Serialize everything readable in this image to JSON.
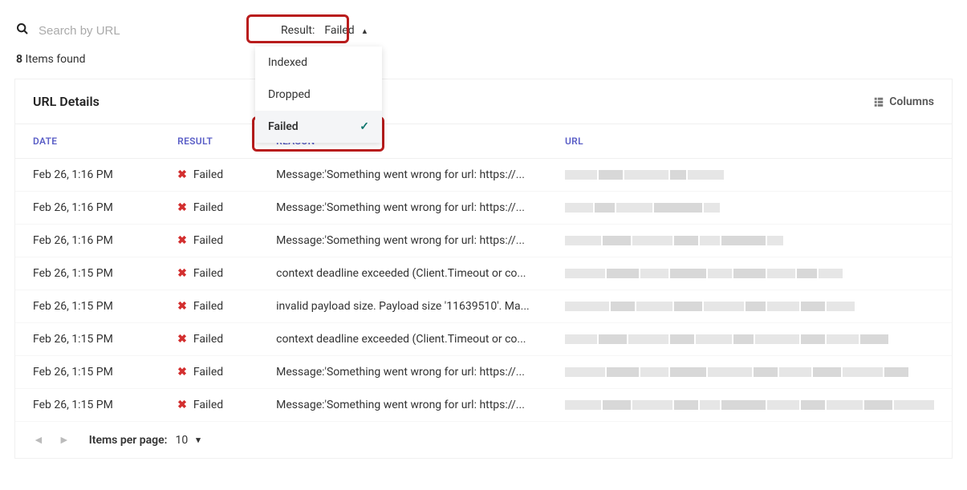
{
  "search": {
    "placeholder": "Search by URL"
  },
  "filter": {
    "label": "Result:",
    "value": "Failed",
    "options": [
      "Indexed",
      "Dropped",
      "Failed"
    ],
    "selected": "Failed"
  },
  "items_found": {
    "count": "8",
    "suffix": "Items found"
  },
  "panel": {
    "title": "URL Details",
    "columns_label": "Columns"
  },
  "columns": {
    "date": "DATE",
    "result": "RESULT",
    "reason": "REASON",
    "url": "URL"
  },
  "rows": [
    {
      "date": "Feb 26, 1:16 PM",
      "result": "Failed",
      "reason": "Message:'Something went wrong for url: https://..."
    },
    {
      "date": "Feb 26, 1:16 PM",
      "result": "Failed",
      "reason": "Message:'Something went wrong for url: https://..."
    },
    {
      "date": "Feb 26, 1:16 PM",
      "result": "Failed",
      "reason": "Message:'Something went wrong for url: https://..."
    },
    {
      "date": "Feb 26, 1:15 PM",
      "result": "Failed",
      "reason": "context deadline exceeded (Client.Timeout or co..."
    },
    {
      "date": "Feb 26, 1:15 PM",
      "result": "Failed",
      "reason": "invalid payload size. Payload size '11639510'. Ma..."
    },
    {
      "date": "Feb 26, 1:15 PM",
      "result": "Failed",
      "reason": "context deadline exceeded (Client.Timeout or co..."
    },
    {
      "date": "Feb 26, 1:15 PM",
      "result": "Failed",
      "reason": "Message:'Something went wrong for url: https://..."
    },
    {
      "date": "Feb 26, 1:15 PM",
      "result": "Failed",
      "reason": "Message:'Something went wrong for url: https://..."
    }
  ],
  "footer": {
    "per_page_label": "Items per page:",
    "per_page_value": "10"
  }
}
